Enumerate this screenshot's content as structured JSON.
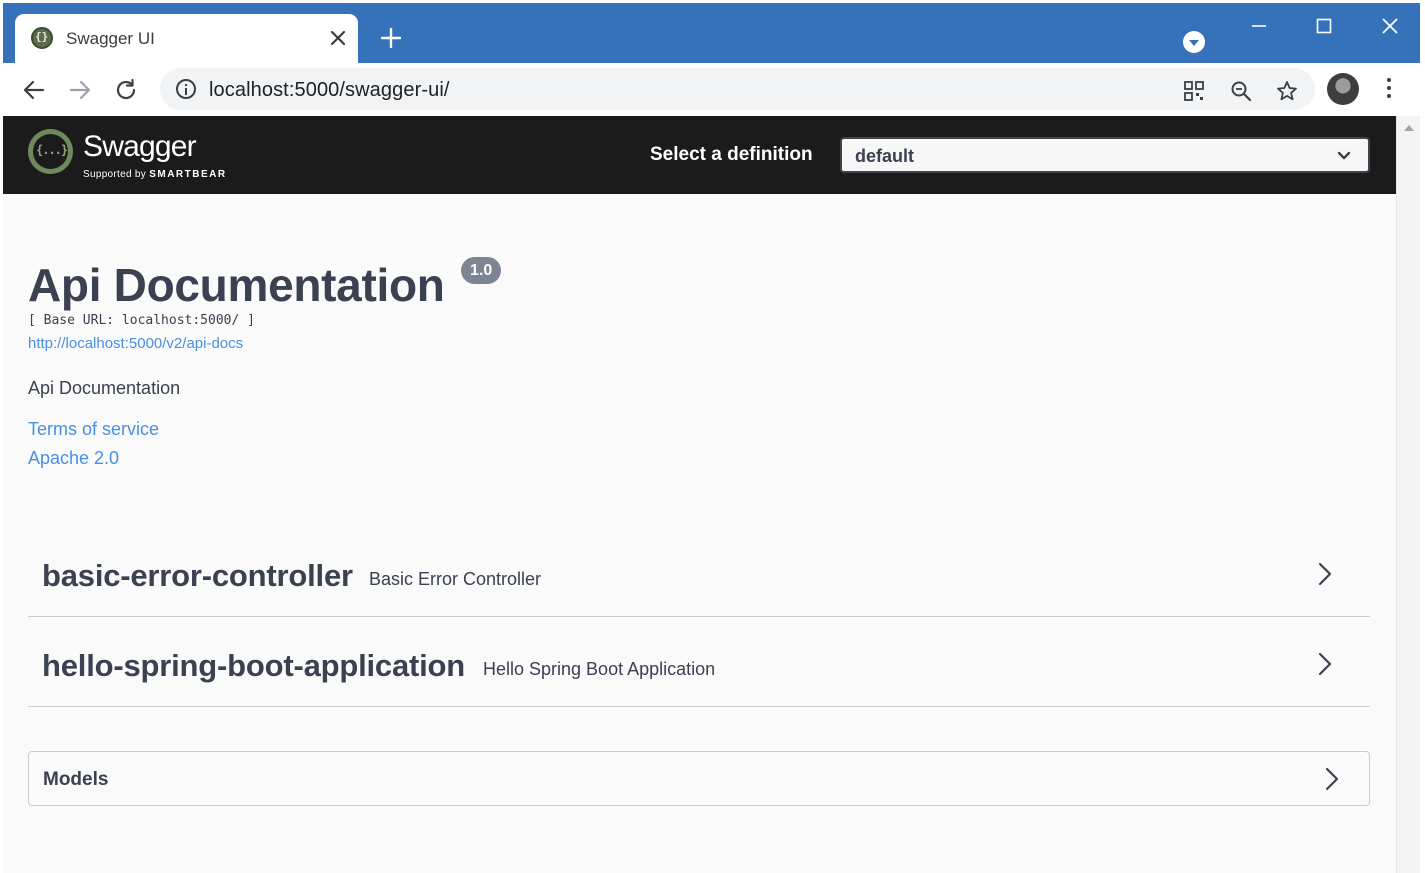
{
  "browser": {
    "tab_title": "Swagger UI",
    "url": "localhost:5000/swagger-ui/"
  },
  "swagger": {
    "brand": "Swagger",
    "supported_by": "Supported by",
    "supported_by_company": "SMARTBEAR",
    "select_label": "Select a definition",
    "selected_definition": "default"
  },
  "info": {
    "title": "Api Documentation",
    "version": "1.0",
    "base_url": "[ Base URL: localhost:5000/ ]",
    "api_docs_url": "http://localhost:5000/v2/api-docs",
    "description": "Api Documentation",
    "terms_of_service": "Terms of service",
    "license": "Apache 2.0"
  },
  "tags": [
    {
      "name": "basic-error-controller",
      "description": "Basic Error Controller"
    },
    {
      "name": "hello-spring-boot-application",
      "description": "Hello Spring Boot Application"
    }
  ],
  "models": {
    "title": "Models"
  },
  "colors": {
    "titlebar": "#3572b9",
    "swagger_topbar": "#1b1b1b",
    "link": "#4990e2",
    "text": "#3b4151",
    "badge": "#7d8492"
  }
}
